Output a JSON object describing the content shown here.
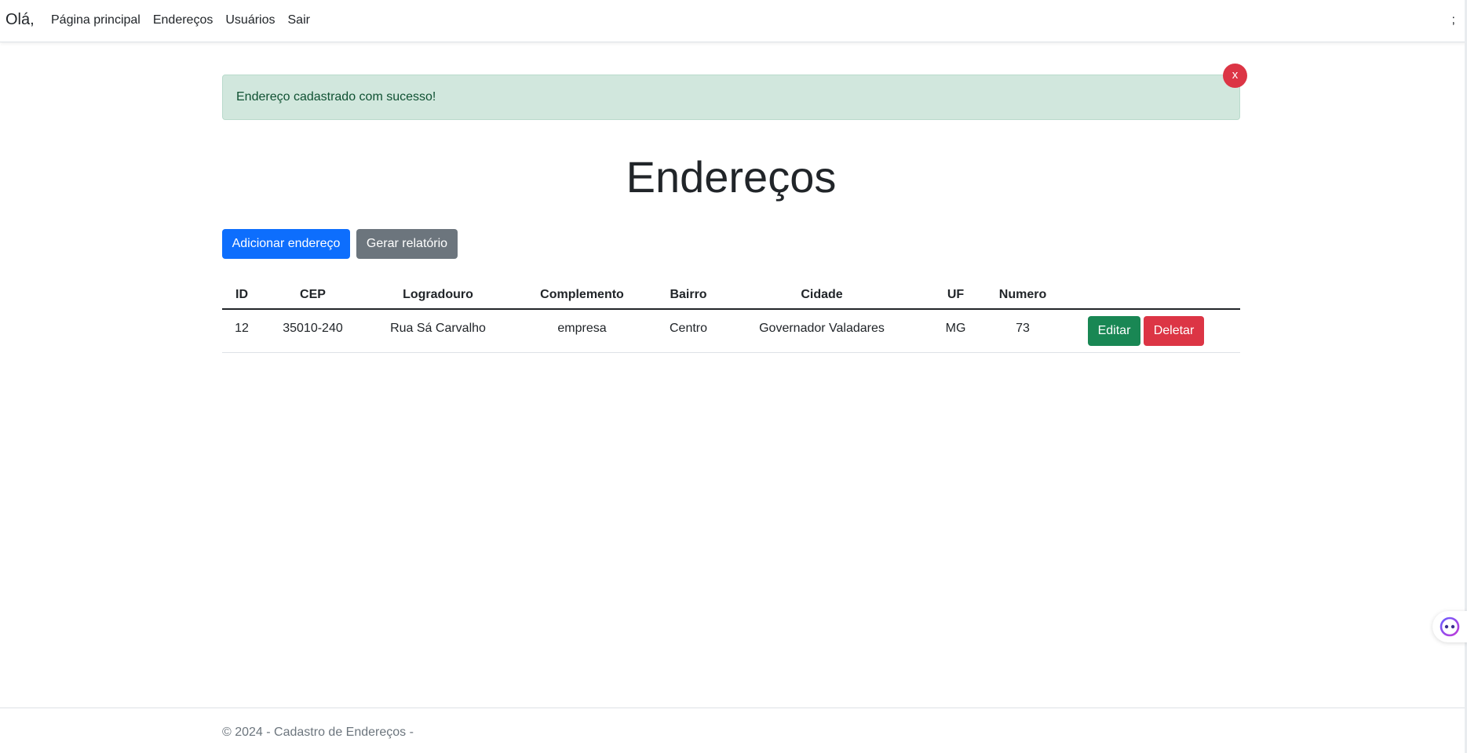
{
  "navbar": {
    "brand": "Olá,",
    "links": [
      "Página principal",
      "Endereços",
      "Usuários",
      "Sair"
    ],
    "right_text": ";"
  },
  "alert": {
    "message": "Endereço cadastrado com sucesso!",
    "close_label": "x"
  },
  "page": {
    "title": "Endereços",
    "add_button": "Adicionar endereço",
    "report_button": "Gerar relatório"
  },
  "table": {
    "headers": [
      "ID",
      "CEP",
      "Logradouro",
      "Complemento",
      "Bairro",
      "Cidade",
      "UF",
      "Numero"
    ],
    "rows": [
      {
        "id": "12",
        "cep": "35010-240",
        "logradouro": "Rua Sá Carvalho",
        "complemento": "empresa",
        "bairro": "Centro",
        "cidade": "Governador Valadares",
        "uf": "MG",
        "numero": "73",
        "edit_label": "Editar",
        "delete_label": "Deletar"
      }
    ]
  },
  "footer": {
    "text": "© 2024 - Cadastro de Endereços -"
  },
  "colors": {
    "primary": "#0d6efd",
    "secondary": "#6c757d",
    "success": "#198754",
    "danger": "#dc3545",
    "alert_bg": "#d1e7dd",
    "alert_text": "#0f5132"
  },
  "icons": {
    "float_widget": "assistant-icon"
  }
}
